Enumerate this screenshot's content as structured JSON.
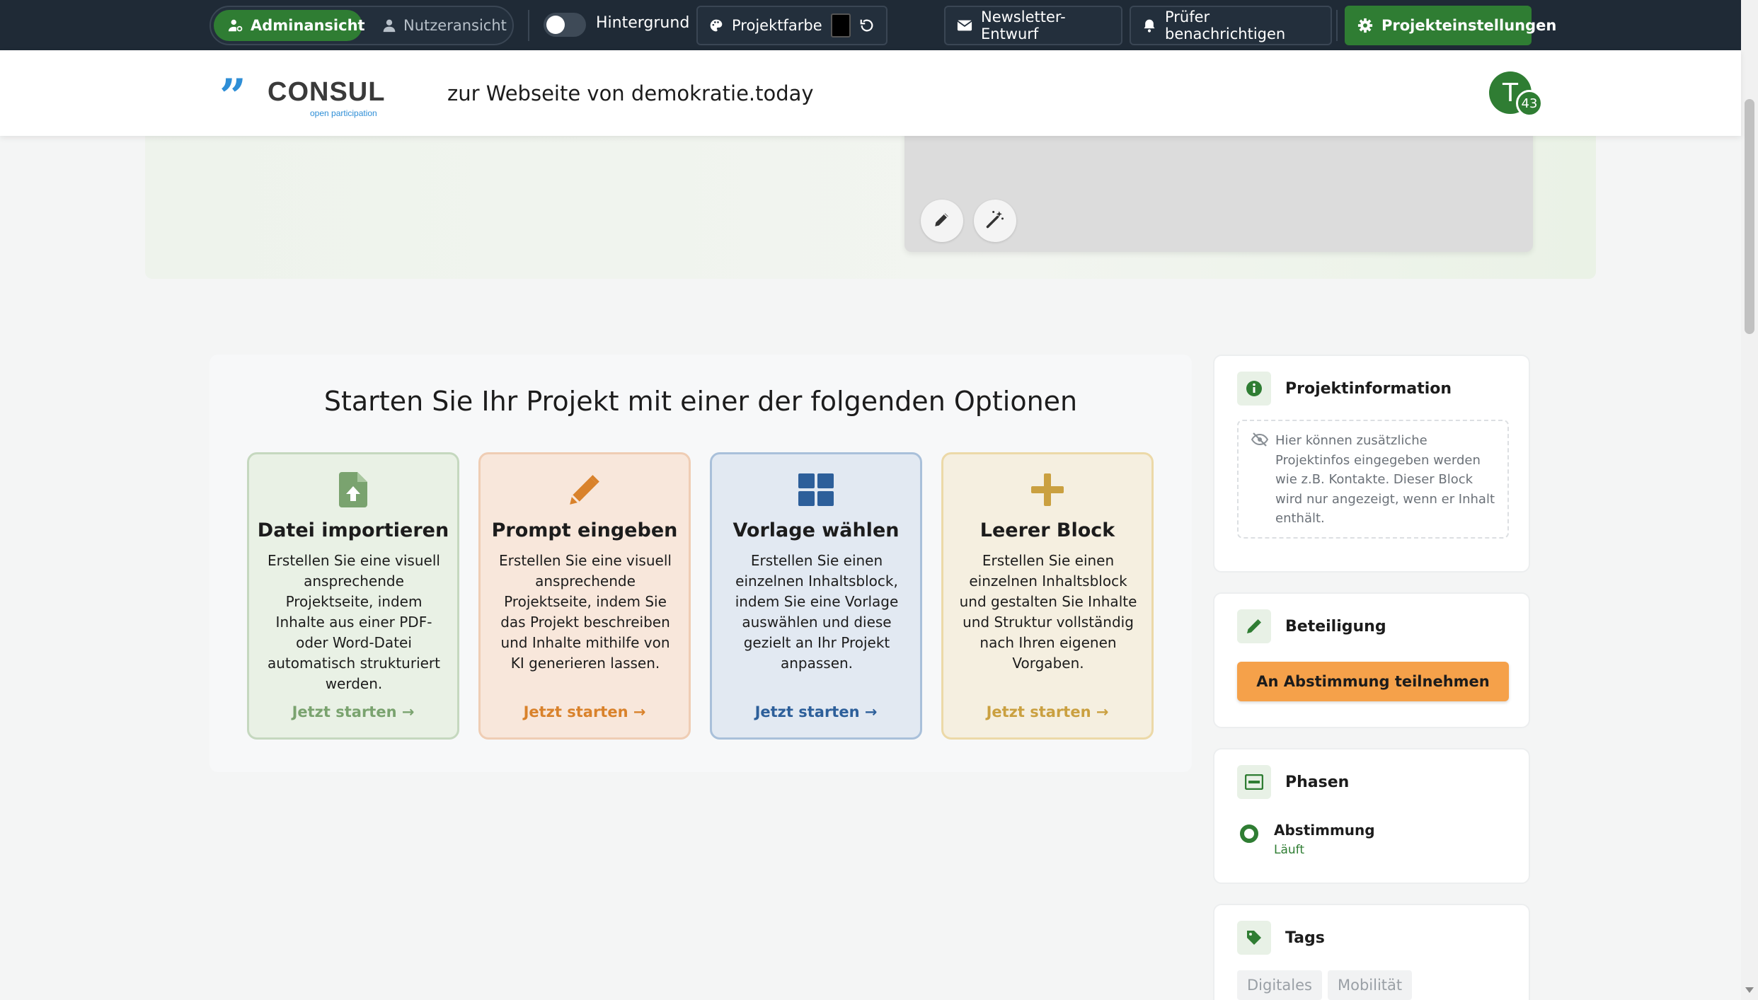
{
  "adminbar": {
    "views": {
      "admin_label": "Adminansicht",
      "user_label": "Nutzeransicht",
      "active": "admin"
    },
    "background_toggle": {
      "label": "Hintergrund",
      "on": false
    },
    "project_color": {
      "label": "Projektfarbe",
      "value": "#000000"
    },
    "newsletter_label": "Newsletter-Entwurf",
    "notify_label": "Prüfer benachrichtigen",
    "settings_label": "Projekteinstellungen"
  },
  "header": {
    "logo_text": "CONSUL",
    "logo_sub": "open participation",
    "site_link": "zur Webseite von demokratie.today",
    "avatar_initial": "T",
    "avatar_badge": "43"
  },
  "hero": {
    "edit_icon": "pencil-icon",
    "magic_icon": "magic-wand-icon"
  },
  "options": {
    "title": "Starten Sie Ihr Projekt mit einer der folgenden Optionen",
    "cards": [
      {
        "title": "Datei importieren",
        "description": "Erstellen Sie eine visuell ansprechende Projektseite, indem Inhalte aus einer PDF- oder Word-Datei automatisch strukturiert werden.",
        "link": "Jetzt starten →",
        "icon": "file-upload-icon",
        "color": "#7aa36f"
      },
      {
        "title": "Prompt eingeben",
        "description": "Erstellen Sie eine visuell ansprechende Projektseite, indem Sie das Projekt beschreiben und Inhalte mithilfe von KI generieren lassen.",
        "link": "Jetzt starten →",
        "icon": "pencil-icon",
        "color": "#d9822b"
      },
      {
        "title": "Vorlage wählen",
        "description": "Erstellen Sie einen einzelnen Inhaltsblock, indem Sie eine Vorlage auswählen und diese gezielt an Ihr Projekt anpassen.",
        "link": "Jetzt starten →",
        "icon": "grid-icon",
        "color": "#2d5f9a"
      },
      {
        "title": "Leerer Block",
        "description": "Erstellen Sie einen einzelnen Inhaltsblock und gestalten Sie Inhalte und Struktur vollständig nach Ihren eigenen Vorgaben.",
        "link": "Jetzt starten →",
        "icon": "plus-icon",
        "color": "#caa040"
      }
    ]
  },
  "sidebar": {
    "project_info": {
      "title": "Projektinformation",
      "hint": "Hier können zusätzliche Projektinfos eingegeben werden wie z.B. Kontakte. Dieser Block wird nur angezeigt, wenn er Inhalt enthält."
    },
    "participation": {
      "title": "Beteiligung",
      "button": "An Abstimmung teilnehmen"
    },
    "phases": {
      "title": "Phasen",
      "phase_name": "Abstimmung",
      "phase_status": "Läuft"
    },
    "tags": {
      "title": "Tags",
      "items": [
        "Digitales",
        "Mobilität"
      ]
    }
  }
}
